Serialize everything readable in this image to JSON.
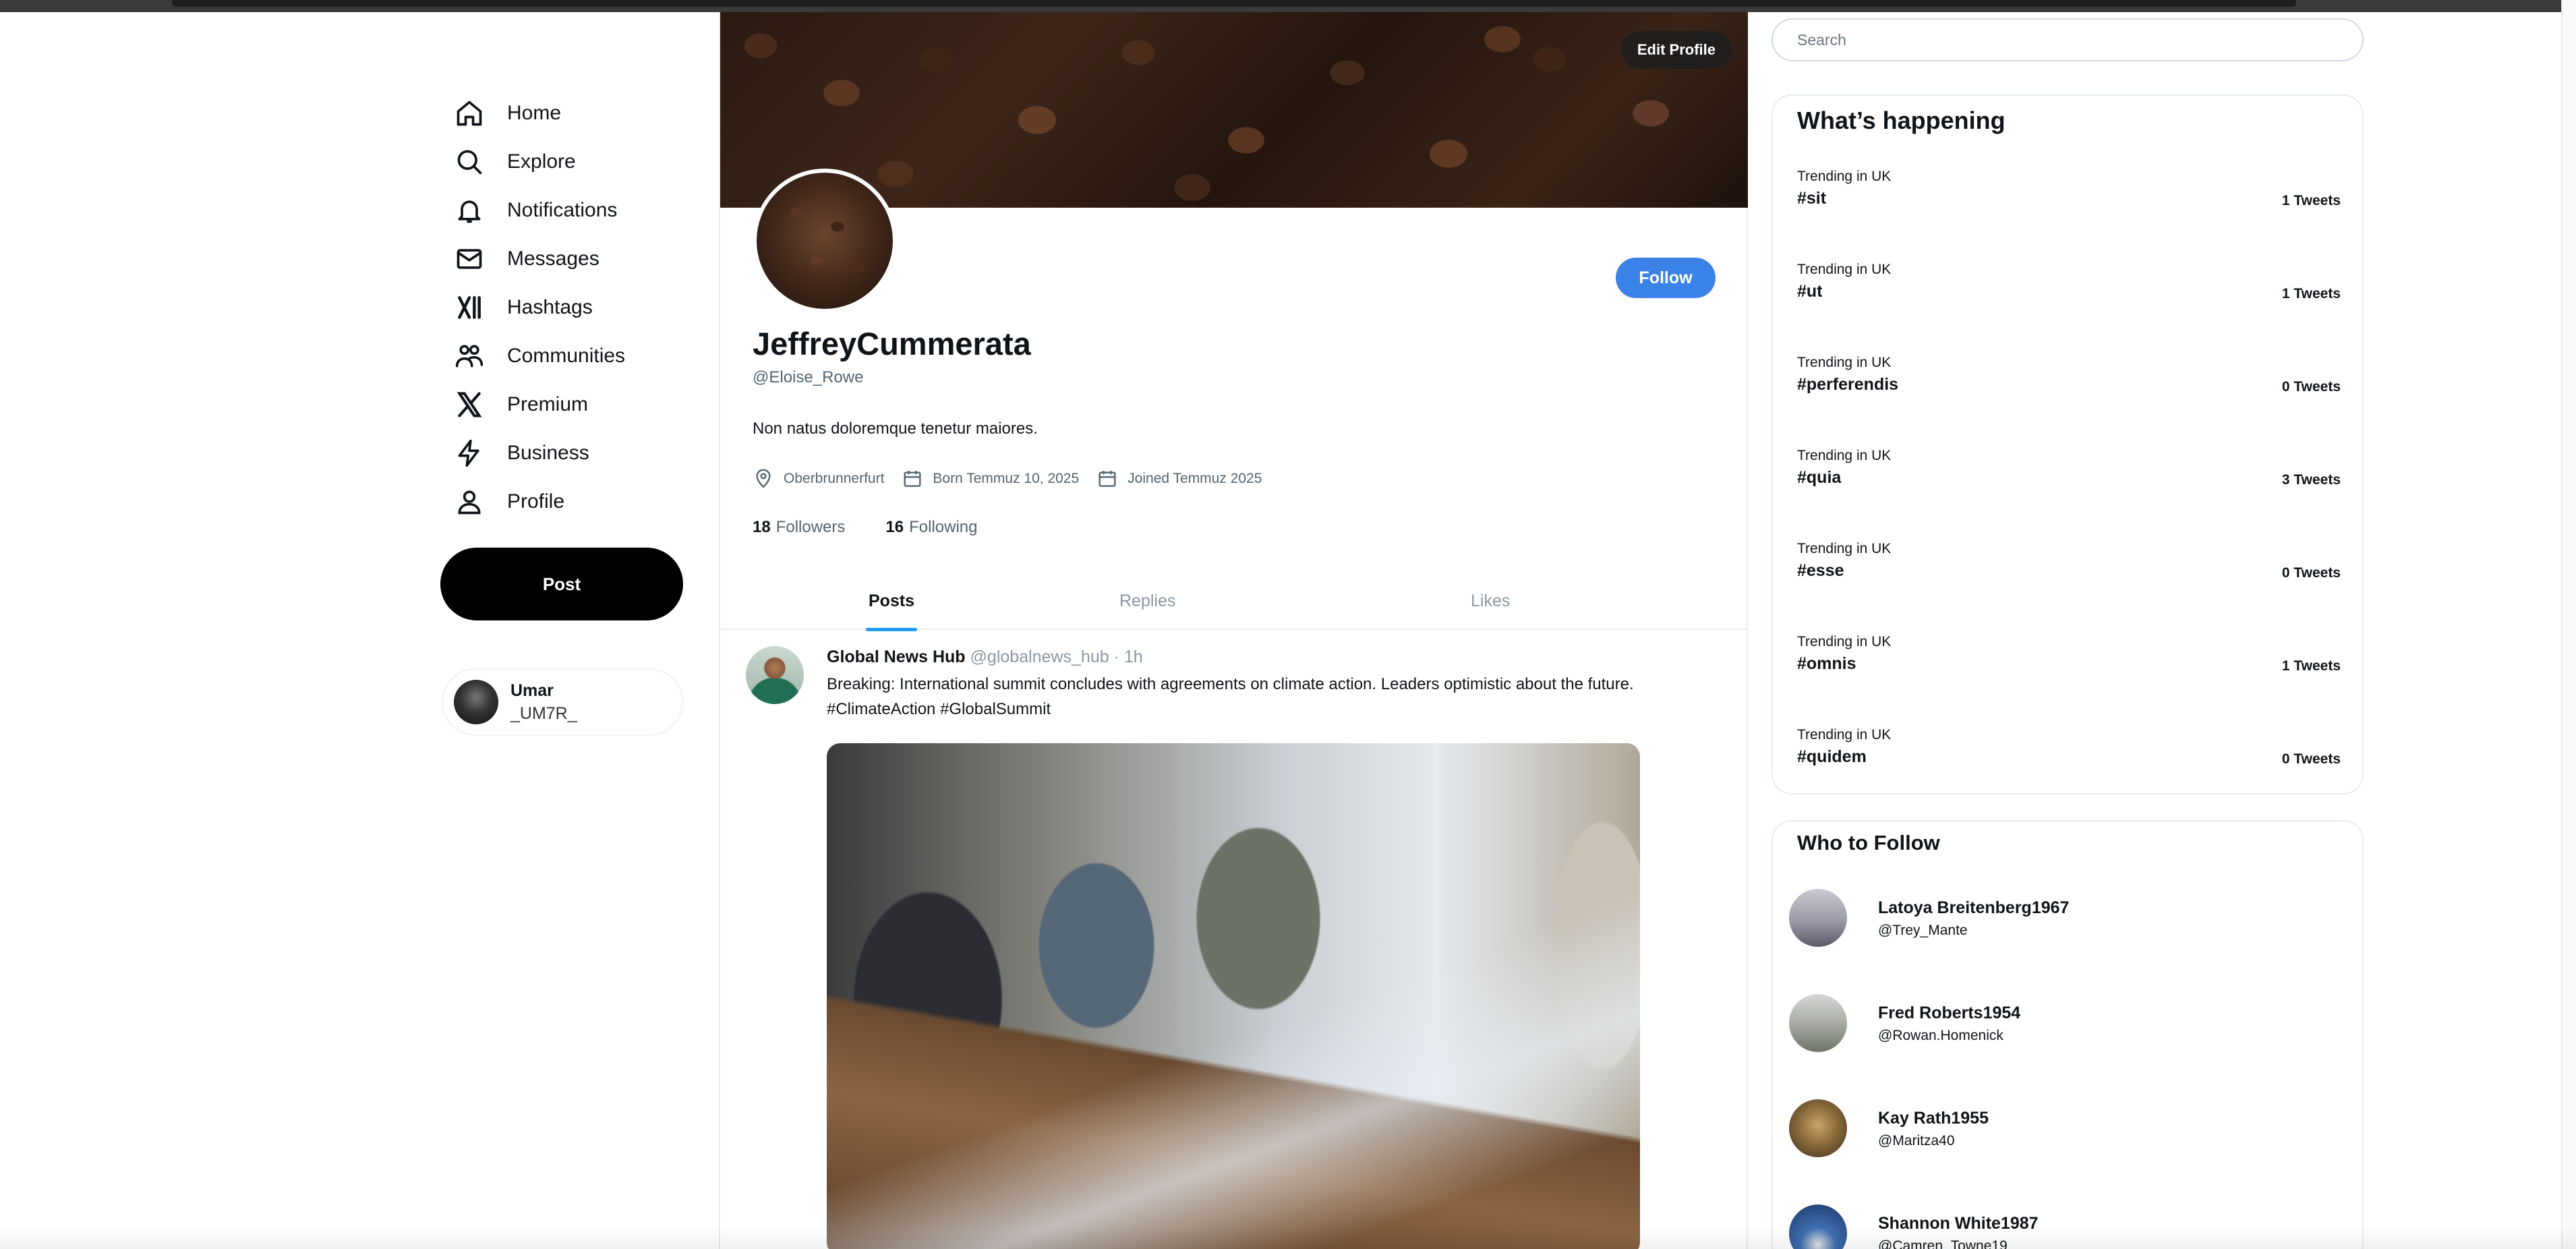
{
  "nav": {
    "items": [
      {
        "label": "Home",
        "icon": "home-icon"
      },
      {
        "label": "Explore",
        "icon": "search-icon"
      },
      {
        "label": "Notifications",
        "icon": "bell-icon"
      },
      {
        "label": "Messages",
        "icon": "envelope-icon"
      },
      {
        "label": "Hashtags",
        "icon": "hashtag-x-icon"
      },
      {
        "label": "Communities",
        "icon": "people-icon"
      },
      {
        "label": "Premium",
        "icon": "x-logo-icon"
      },
      {
        "label": "Business",
        "icon": "lightning-icon"
      },
      {
        "label": "Profile",
        "icon": "person-icon"
      }
    ],
    "post_label": "Post",
    "account": {
      "name": "Umar",
      "handle": "_UM7R_"
    }
  },
  "profile": {
    "edit_label": "Edit Profile",
    "follow_label": "Follow",
    "name": "JeffreyCummerata",
    "handle": "@Eloise_Rowe",
    "bio": "Non natus doloremque tenetur maiores.",
    "location": "Oberbrunnerfurt",
    "born": "Born Temmuz 10, 2025",
    "joined": "Joined Temmuz 2025",
    "followers_count": "18",
    "followers_label": "Followers",
    "following_count": "16",
    "following_label": "Following"
  },
  "tabs": [
    {
      "label": "Posts",
      "active": true
    },
    {
      "label": "Replies",
      "active": false
    },
    {
      "label": "Likes",
      "active": false
    }
  ],
  "tweet": {
    "author": "Global News Hub",
    "meta": "@globalnews_hub · 1h",
    "text": "Breaking: International summit concludes with agreements on climate action. Leaders optimistic about the future. #ClimateAction #GlobalSummit"
  },
  "sidebar": {
    "search_placeholder": "Search",
    "trends_title": "What’s happening",
    "trends": [
      {
        "category": "Trending in UK",
        "tag": "#sit",
        "count": "1 Tweets"
      },
      {
        "category": "Trending in UK",
        "tag": "#ut",
        "count": "1 Tweets"
      },
      {
        "category": "Trending in UK",
        "tag": "#perferendis",
        "count": "0 Tweets"
      },
      {
        "category": "Trending in UK",
        "tag": "#quia",
        "count": "3 Tweets"
      },
      {
        "category": "Trending in UK",
        "tag": "#esse",
        "count": "0 Tweets"
      },
      {
        "category": "Trending in UK",
        "tag": "#omnis",
        "count": "1 Tweets"
      },
      {
        "category": "Trending in UK",
        "tag": "#quidem",
        "count": "0 Tweets"
      }
    ],
    "who_title": "Who to Follow",
    "who": [
      {
        "name": "Latoya Breitenberg1967",
        "handle": "@Trey_Mante"
      },
      {
        "name": "Fred Roberts1954",
        "handle": "@Rowan.Homenick"
      },
      {
        "name": "Kay Rath1955",
        "handle": "@Maritza40"
      },
      {
        "name": "Shannon White1987",
        "handle": "@Camren_Towne19"
      }
    ]
  },
  "colors": {
    "accent": "#1d9bf0",
    "follow_button": "#3b82e8",
    "post_button": "#000000"
  }
}
